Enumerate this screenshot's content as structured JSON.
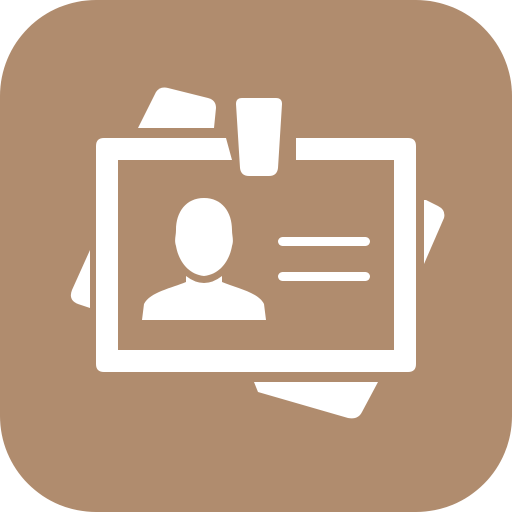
{
  "icon": {
    "name": "id-badge-icon",
    "background_color": "#B08C6E",
    "foreground_color": "#FFFFFF"
  }
}
